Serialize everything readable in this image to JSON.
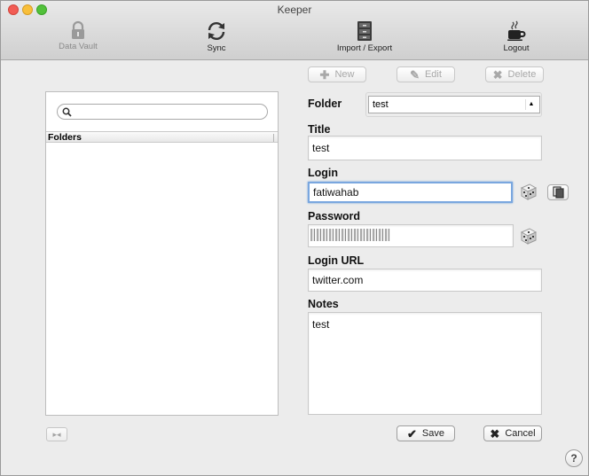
{
  "window": {
    "title": "Keeper"
  },
  "toolbar": {
    "data_vault": "Data Vault",
    "sync": "Sync",
    "import_export": "Import / Export",
    "logout": "Logout"
  },
  "sidebar": {
    "search_placeholder": "",
    "folders_header": "Folders"
  },
  "actions": {
    "new": "New",
    "edit": "Edit",
    "delete": "Delete"
  },
  "form": {
    "folder_label": "Folder",
    "folder_value": "test",
    "title_label": "Title",
    "title_value": "test",
    "login_label": "Login",
    "login_value": "fatiwahab",
    "password_label": "Password",
    "password_value": "",
    "login_url_label": "Login URL",
    "login_url_value": "twitter.com",
    "notes_label": "Notes",
    "notes_value": "test"
  },
  "footer": {
    "save": "Save",
    "cancel": "Cancel",
    "help": "?",
    "collapse": "▸◂"
  }
}
